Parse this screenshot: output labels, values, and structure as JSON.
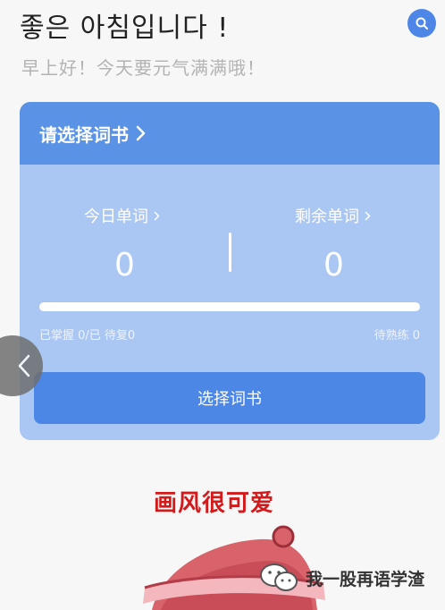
{
  "header": {
    "greeting": "좋은 아침입니다 !",
    "subtitle": "早上好！今天要元气满满哦！"
  },
  "card": {
    "header_label": "请选择词书",
    "today_label": "今日单词",
    "today_value": "0",
    "remaining_label": "剩余单词",
    "remaining_value": "0",
    "progress": 0,
    "left_note": "已掌握 0/已 待复0",
    "right_note": "待熟练 0",
    "button_label": "选择词书"
  },
  "caption": "画风很可爱",
  "watermark": "我一股再语学渣",
  "icons": [
    "search-icon",
    "chevron-right-icon",
    "back-arrow-icon",
    "hat-illustration",
    "wechat-icon"
  ],
  "colors": {
    "accent": "#4e86e8",
    "card_bg": "#aac7f4",
    "card_header": "#5a93e6",
    "caption": "#d31919"
  }
}
